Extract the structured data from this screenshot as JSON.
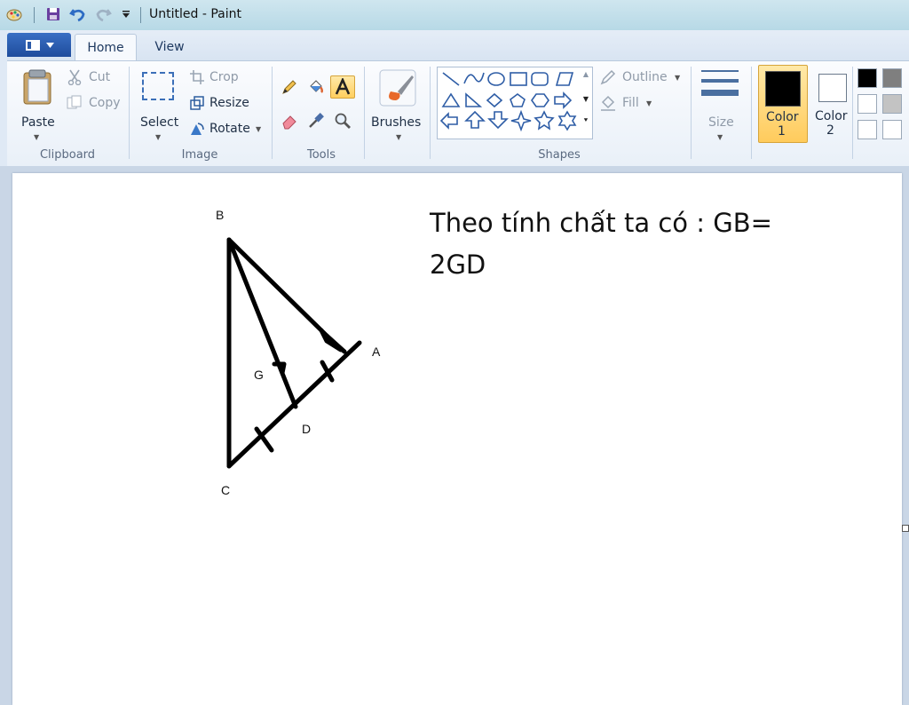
{
  "window": {
    "title": "Untitled - Paint"
  },
  "tabs": [
    {
      "label": "Home"
    },
    {
      "label": "View"
    }
  ],
  "clipboard": {
    "paste": "Paste",
    "cut": "Cut",
    "copy": "Copy",
    "group": "Clipboard"
  },
  "image": {
    "select": "Select",
    "crop": "Crop",
    "resize": "Resize",
    "rotate": "Rotate",
    "group": "Image"
  },
  "tools": {
    "group": "Tools"
  },
  "brushes": {
    "label": "Brushes"
  },
  "shapes": {
    "outline": "Outline",
    "fill": "Fill",
    "group": "Shapes"
  },
  "size": {
    "label": "Size"
  },
  "colors": {
    "color1_label": "Color",
    "color1_number": "1",
    "color2_label": "Color",
    "color2_number": "2",
    "color1_value": "#000000",
    "color2_value": "#ffffff",
    "palette": [
      "#000000",
      "#7f7f7f",
      "#ffffff",
      "#c3c3c3",
      "#ffffff",
      "#ffffff"
    ]
  },
  "canvas": {
    "text_line1": "Theo tính chất ta có : GB=",
    "text_line2": "2GD",
    "vertices": {
      "a": "A",
      "b": "B",
      "c": "C",
      "d": "D",
      "g": "G"
    }
  }
}
